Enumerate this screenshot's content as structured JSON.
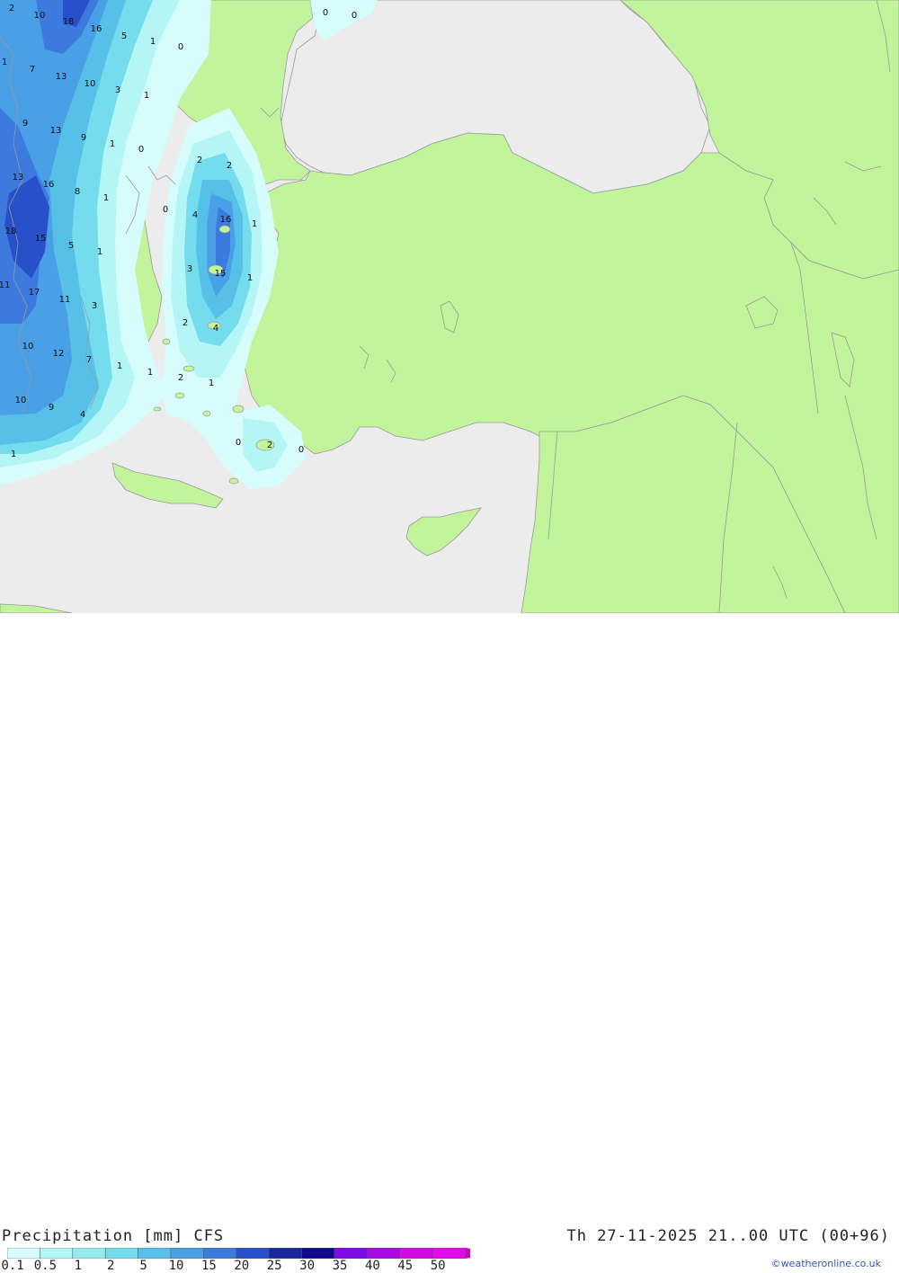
{
  "title": "Precipitation [mm] CFS",
  "valid_time": "Th 27-11-2025 21..00 UTC (00+96)",
  "credit": "©weatheronline.co.uk",
  "legend": {
    "ticks": [
      "0.1",
      "0.5",
      "1",
      "2",
      "5",
      "10",
      "15",
      "20",
      "25",
      "30",
      "35",
      "40",
      "45",
      "50"
    ],
    "colors": [
      "#d6fcfc",
      "#b4f5f5",
      "#96ecec",
      "#74dcec",
      "#56c0e8",
      "#4aa0e6",
      "#3c7ade",
      "#2850c8",
      "#1a28a0",
      "#100a8a",
      "#7c0aea",
      "#a80ae6",
      "#d40ae0",
      "#e20ae8",
      "#c20ab6"
    ]
  },
  "map_colors": {
    "sea": "#ececec",
    "land": "#c2f49c",
    "border": "#9a9a9a"
  },
  "contour_labels": [
    {
      "text": "2"
    },
    {
      "text": "10"
    },
    {
      "text": "18"
    },
    {
      "text": "16"
    },
    {
      "text": "5"
    },
    {
      "text": "1"
    },
    {
      "text": "0"
    },
    {
      "text": "0"
    },
    {
      "text": "0"
    },
    {
      "text": "1"
    },
    {
      "text": "7"
    },
    {
      "text": "13"
    },
    {
      "text": "10"
    },
    {
      "text": "3"
    },
    {
      "text": "1"
    },
    {
      "text": "9"
    },
    {
      "text": "13"
    },
    {
      "text": "9"
    },
    {
      "text": "1"
    },
    {
      "text": "0"
    },
    {
      "text": "2"
    },
    {
      "text": "2"
    },
    {
      "text": "13"
    },
    {
      "text": "16"
    },
    {
      "text": "8"
    },
    {
      "text": "1"
    },
    {
      "text": "0"
    },
    {
      "text": "4"
    },
    {
      "text": "16"
    },
    {
      "text": "1"
    },
    {
      "text": "18"
    },
    {
      "text": "15"
    },
    {
      "text": "5"
    },
    {
      "text": "1"
    },
    {
      "text": "3"
    },
    {
      "text": "15"
    },
    {
      "text": "1"
    },
    {
      "text": "11"
    },
    {
      "text": "17"
    },
    {
      "text": "11"
    },
    {
      "text": "3"
    },
    {
      "text": "2"
    },
    {
      "text": "4"
    },
    {
      "text": "10"
    },
    {
      "text": "12"
    },
    {
      "text": "7"
    },
    {
      "text": "1"
    },
    {
      "text": "1"
    },
    {
      "text": "2"
    },
    {
      "text": "1"
    },
    {
      "text": "10"
    },
    {
      "text": "9"
    },
    {
      "text": "4"
    },
    {
      "text": "0"
    },
    {
      "text": "2"
    },
    {
      "text": "0"
    },
    {
      "text": "1"
    }
  ]
}
